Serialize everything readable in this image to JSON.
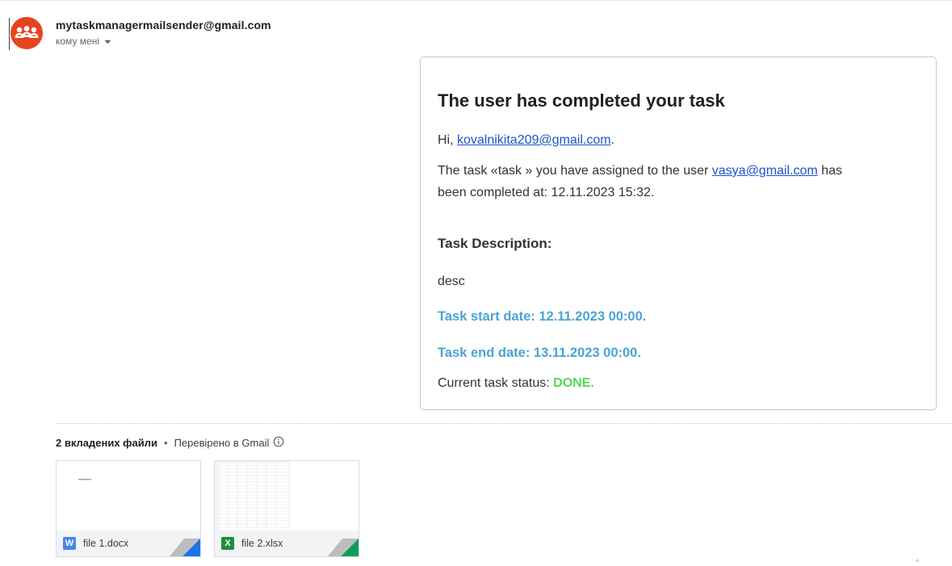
{
  "sender": {
    "email": "mytaskmanagermailsender@gmail.com",
    "recipient_label": "кому мені",
    "avatar_color": "#e8431f"
  },
  "message": {
    "title": "The user has completed your task",
    "greeting_prefix": "Hi, ",
    "greeting_email": "kovalnikita209@gmail.com",
    "greeting_suffix": ".",
    "body_prefix": "The task «task » you have assigned to the user ",
    "body_email": "vasya@gmail.com",
    "body_suffix_line1": " has",
    "body_line2": "been completed at: 12.11.2023 15:32.",
    "description_heading": "Task Description:",
    "description": "desc",
    "start_date": "Task start date: 12.11.2023 00:00.",
    "end_date": "Task end date: 13.11.2023 00:00.",
    "status_label": "Current task status: ",
    "status_value": "DONE.",
    "link_color": "#1a56c4",
    "date_color": "#4aa3d6",
    "status_color": "#56d65a"
  },
  "attachments": {
    "count_label": "2 вкладених файли",
    "separator": "•",
    "scan_label": "Перевірено в Gmail",
    "files": [
      {
        "name": "file 1.docx",
        "type_letter": "W",
        "type_color": "#4a86e8",
        "corner_color": "#1a73e8"
      },
      {
        "name": "file 2.xlsx",
        "type_letter": "X",
        "type_color": "#1e8e3e",
        "corner_color": "#0f9d58"
      }
    ]
  },
  "scroll_caret": "^"
}
